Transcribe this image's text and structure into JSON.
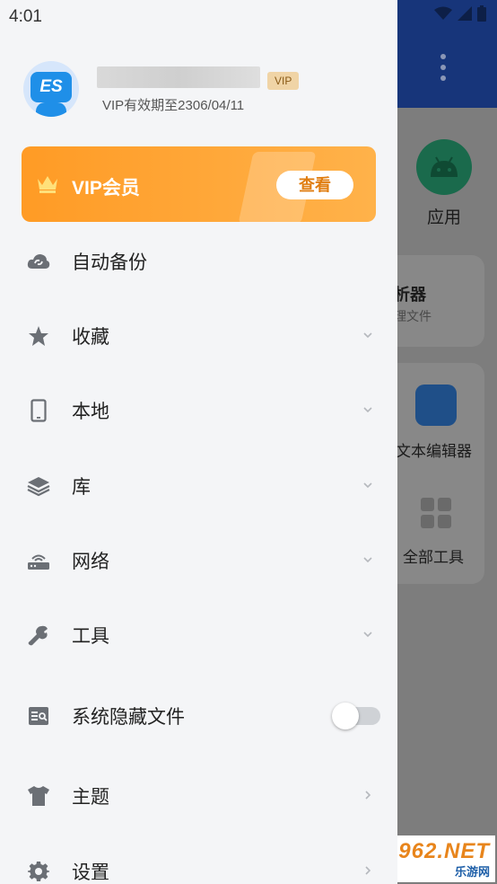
{
  "status_bar": {
    "time": "4:01"
  },
  "profile": {
    "vip_badge": "VIP",
    "expiry_text": "VIP有效期至2306/04/11"
  },
  "vip_banner": {
    "title": "VIP会员",
    "button_label": "查看",
    "accent_color": "#ff9b25"
  },
  "menu": {
    "items": [
      {
        "label": "自动备份",
        "icon": "cloud-sync-icon",
        "trailing": "none"
      },
      {
        "label": "收藏",
        "icon": "star-icon",
        "trailing": "chevron-down"
      },
      {
        "label": "本地",
        "icon": "phone-icon",
        "trailing": "chevron-down"
      },
      {
        "label": "库",
        "icon": "layers-icon",
        "trailing": "chevron-down"
      },
      {
        "label": "网络",
        "icon": "router-icon",
        "trailing": "chevron-down"
      },
      {
        "label": "工具",
        "icon": "wrench-icon",
        "trailing": "chevron-down"
      },
      {
        "label": "系统隐藏文件",
        "icon": "hidden-file-icon",
        "trailing": "toggle",
        "toggle_on": false
      },
      {
        "label": "主题",
        "icon": "tshirt-icon",
        "trailing": "chevron-right"
      },
      {
        "label": "设置",
        "icon": "gear-icon",
        "trailing": "chevron-right"
      }
    ]
  },
  "background_app": {
    "apps_label": "应用",
    "analyzer_title": "析器",
    "analyzer_sub": "理文件",
    "text_editor_label": "文本编辑器",
    "all_tools_label": "全部工具"
  },
  "watermark": {
    "brand": "962.NET",
    "sub": "乐游网"
  }
}
